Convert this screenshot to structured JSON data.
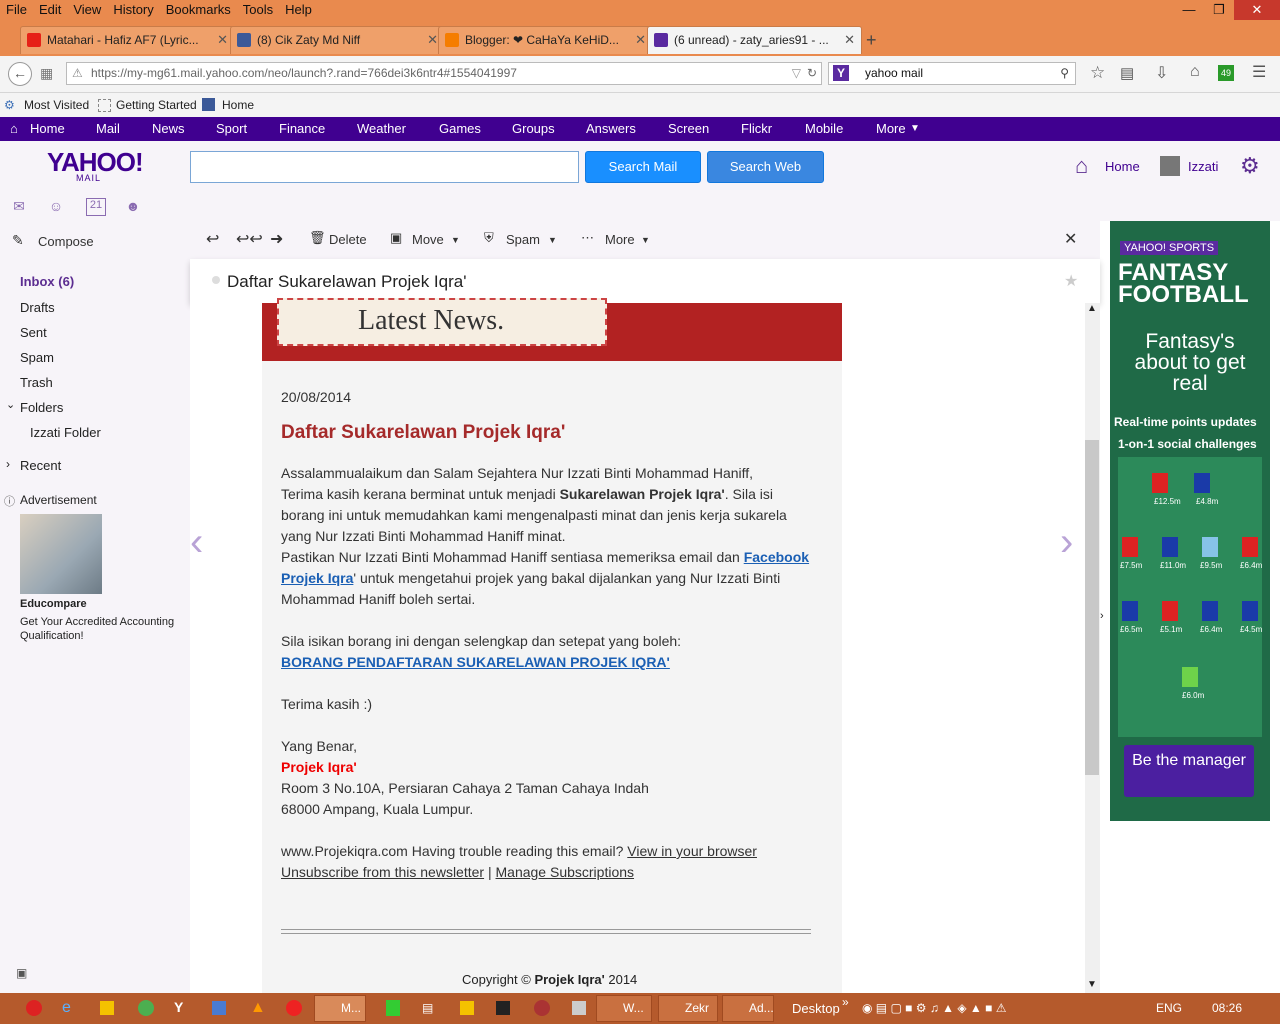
{
  "browser": {
    "menu": [
      "File",
      "Edit",
      "View",
      "History",
      "Bookmarks",
      "Tools",
      "Help"
    ],
    "tabs": [
      {
        "title": "Matahari - Hafiz AF7 (Lyric..."
      },
      {
        "title": "(8) Cik Zaty Md Niff"
      },
      {
        "title": "Blogger: ❤ CaHaYa KeHiD..."
      },
      {
        "title": "(6 unread) - zaty_aries91 - ..."
      }
    ],
    "url": "https://my-mg61.mail.yahoo.com/neo/launch?.rand=766dei3k6ntr4#1554041997",
    "search_value": "yahoo mail",
    "bookmarks": [
      "Most Visited",
      "Getting Started",
      "Home"
    ],
    "badge": "49"
  },
  "yahoo_nav": [
    "Home",
    "Mail",
    "News",
    "Sport",
    "Finance",
    "Weather",
    "Games",
    "Groups",
    "Answers",
    "Screen",
    "Flickr",
    "Mobile",
    "More"
  ],
  "header": {
    "logo": "YAHOO!",
    "logo_sub": "MAIL",
    "search_mail": "Search Mail",
    "search_web": "Search Web",
    "home": "Home",
    "user": "Izzati"
  },
  "sidebar": {
    "compose": "Compose",
    "folders": [
      "Inbox (6)",
      "Drafts",
      "Sent",
      "Spam",
      "Trash",
      "Folders",
      "Izzati Folder",
      "Recent"
    ],
    "ad_label": "Advertisement",
    "ad_title": "Educompare",
    "ad_text": "Get Your Accredited Accounting Qualification!"
  },
  "toolbar": {
    "delete": "Delete",
    "move": "Move",
    "spam": "Spam",
    "more": "More"
  },
  "message": {
    "subject": "Daftar Sukarelawan Projek Iqra'",
    "banner": "Latest News.",
    "date": "20/08/2014",
    "title": "Daftar Sukarelawan Projek Iqra'",
    "p1_line1": "Assalammualaikum dan Salam Sejahtera Nur Izzati Binti Mohammad Haniff,",
    "p1_line2a": "Terima kasih kerana berminat untuk menjadi ",
    "p1_line2b": "Sukarelawan Projek Iqra'",
    "p1_line2c": ". Sila isi",
    "p1_line3": "borang ini untuk memudahkan kami mengenalpasti minat dan jenis kerja sukarela",
    "p1_line4": "yang Nur Izzati Binti Mohammad Haniff minat.",
    "p2_line1a": "Pastikan Nur Izzati Binti Mohammad Haniff sentiasa memeriksa email dan ",
    "p2_link1": "Facebook",
    "p2_link2": "Projek Iqra",
    "p2_line2b": "' untuk mengetahui projek yang bakal dijalankan yang Nur Izzati Binti",
    "p2_line3": "Mohammad Haniff boleh sertai.",
    "p3": "Sila isikan borang ini dengan selengkap dan setepat yang boleh:",
    "form_link": "BORANG PENDAFTARAN SUKARELAWAN PROJEK IQRA'",
    "thanks": "Terima kasih :)",
    "regards": "Yang Benar,",
    "org": "Projek Iqra'",
    "addr1": "Room 3 No.10A, Persiaran Cahaya 2 Taman Cahaya Indah",
    "addr2": "68000 Ampang, Kuala Lumpur.",
    "footer_text": "www.Projekiqra.com Having trouble reading this email? ",
    "view_browser": "View in your browser",
    "unsubscribe": "Unsubscribe from this newsletter",
    "sep": " | ",
    "manage": "Manage Subscriptions",
    "copyright_a": "Copyright © ",
    "copyright_b": "Projek Iqra'",
    "copyright_c": " 2014"
  },
  "ad": {
    "brand": "YAHOO! SPORTS",
    "title1": "FANTASY",
    "title2": "FOOTBALL",
    "tag": "Fantasy's about to get real",
    "line1": "Real-time points updates",
    "line2": "1-on-1 social challenges",
    "prices": [
      "£12.5m",
      "£4.8m",
      "£7.5m",
      "£11.0m",
      "£9.5m",
      "£6.4m",
      "£6.5m",
      "£5.1m",
      "£6.4m",
      "£4.5m",
      "£6.0m"
    ],
    "cta": "Be the manager"
  },
  "taskbar": {
    "items": [
      "M...",
      "W...",
      "Zekr",
      "Ad..."
    ],
    "desktop": "Desktop",
    "lang": "ENG",
    "time": "08:26"
  }
}
